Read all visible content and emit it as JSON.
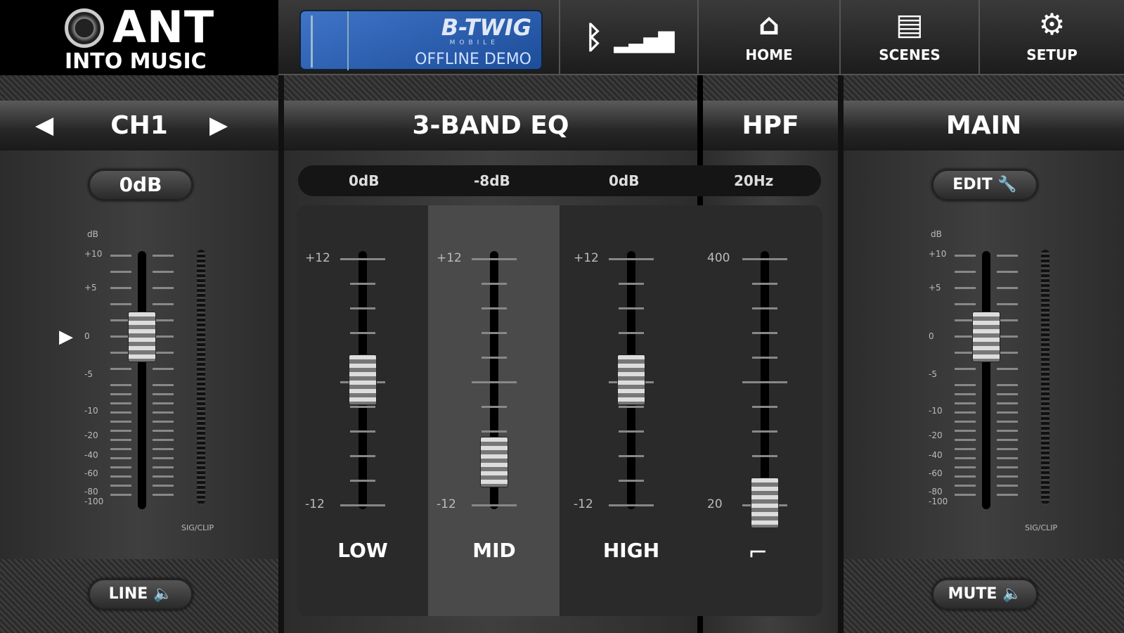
{
  "header": {
    "logo_title": "ANT",
    "logo_subtitle": "INTO MUSIC",
    "product": "B-TWIG",
    "product_sub": "MOBILE",
    "mode": "OFFLINE DEMO",
    "buttons": [
      {
        "label": "HOME",
        "icon": "home-icon"
      },
      {
        "label": "SCENES",
        "icon": "scenes-icon"
      },
      {
        "label": "SETUP",
        "icon": "gear-icon"
      }
    ]
  },
  "channel": {
    "name": "CH1",
    "gain": "0dB",
    "input": "LINE",
    "meter_label": "SIG/CLIP",
    "scale_unit": "dB",
    "scale": [
      "+10",
      "+5",
      "0",
      "-5",
      "-10",
      "-20",
      "-40",
      "-60",
      "-80",
      "-100"
    ],
    "fader_db": 0
  },
  "eq": {
    "title": "3-BAND EQ",
    "bands": [
      {
        "label": "LOW",
        "value": "0dB",
        "gain": 0
      },
      {
        "label": "MID",
        "value": "-8dB",
        "gain": -8
      },
      {
        "label": "HIGH",
        "value": "0dB",
        "gain": 0
      }
    ],
    "scale_top": "+12",
    "scale_bottom": "-12",
    "range": [
      -12,
      12
    ]
  },
  "hpf": {
    "title": "HPF",
    "value": "20Hz",
    "scale_top": "400",
    "scale_bottom": "20",
    "freq": 20,
    "range": [
      20,
      400
    ]
  },
  "main": {
    "title": "MAIN",
    "edit": "EDIT",
    "mute": "MUTE",
    "meter_label": "SIG/CLIP",
    "scale_unit": "dB",
    "scale": [
      "+10",
      "+5",
      "0",
      "-5",
      "-10",
      "-20",
      "-40",
      "-60",
      "-80",
      "-100"
    ],
    "fader_db": 0
  }
}
